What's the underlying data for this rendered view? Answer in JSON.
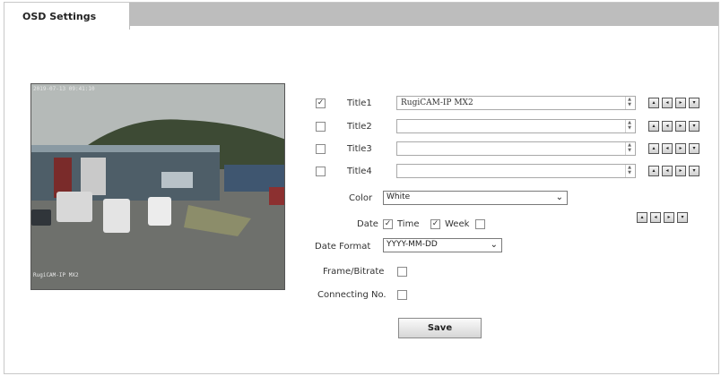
{
  "tab": {
    "label": "OSD Settings"
  },
  "preview": {
    "osd_top": "2019-07-13 09:41:10",
    "osd_bottom": "RugiCAM-IP MX2"
  },
  "titles": [
    {
      "label": "Title1",
      "checked": true,
      "value": "RugiCAM-IP MX2"
    },
    {
      "label": "Title2",
      "checked": false,
      "value": ""
    },
    {
      "label": "Title3",
      "checked": false,
      "value": ""
    },
    {
      "label": "Title4",
      "checked": false,
      "value": ""
    }
  ],
  "position_buttons": [
    "▴",
    "◂",
    "▸",
    "▾"
  ],
  "color": {
    "label": "Color",
    "value": "White"
  },
  "date": {
    "label": "Date",
    "checked": true,
    "time_label": "Time",
    "time_checked": true,
    "week_label": "Week",
    "week_checked": false
  },
  "date_format": {
    "label": "Date Format",
    "value": "YYYY-MM-DD"
  },
  "frame_bitrate": {
    "label": "Frame/Bitrate",
    "checked": false
  },
  "connecting_no": {
    "label": "Connecting No.",
    "checked": false
  },
  "save": {
    "label": "Save"
  },
  "check_mark": "✓"
}
